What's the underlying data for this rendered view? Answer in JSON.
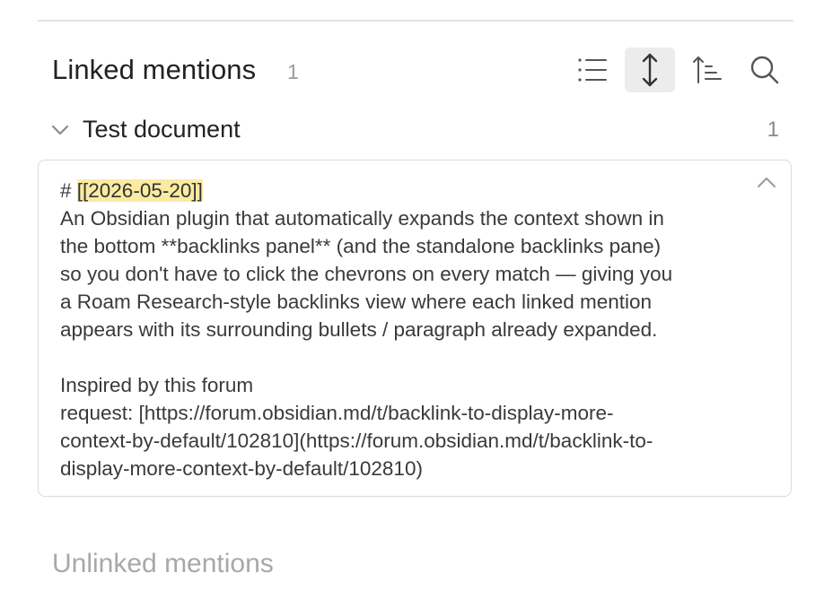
{
  "linked_mentions": {
    "title": "Linked mentions",
    "count": "1",
    "toolbar": {
      "collapse_results_icon": "list-icon",
      "show_more_context_icon": "expand-vertical-icon",
      "sort_icon": "sort-ascending-icon",
      "search_icon": "search-icon"
    }
  },
  "group": {
    "title": "Test document",
    "count": "1"
  },
  "match": {
    "heading_prefix": "# ",
    "heading_link": "[[2026-05-20]]",
    "lines": [
      "An Obsidian plugin that automatically expands the context shown in",
      "the bottom **backlinks panel** (and the standalone backlinks pane)",
      "so you don't have to click the chevrons on every match — giving you",
      "a Roam Research-style backlinks view where each linked mention",
      "appears with its surrounding bullets / paragraph already expanded."
    ],
    "lines2": [
      "Inspired by this forum",
      "request: [https://forum.obsidian.md/t/backlink-to-display-more-",
      "context-by-default/102810](https://forum.obsidian.md/t/backlink-to-",
      "display-more-context-by-default/102810)"
    ]
  },
  "unlinked_mentions": {
    "title": "Unlinked mentions"
  },
  "colors": {
    "highlight": "#fbeaa2",
    "active_button_bg": "#ececec",
    "muted_text": "#a8a8a8"
  }
}
